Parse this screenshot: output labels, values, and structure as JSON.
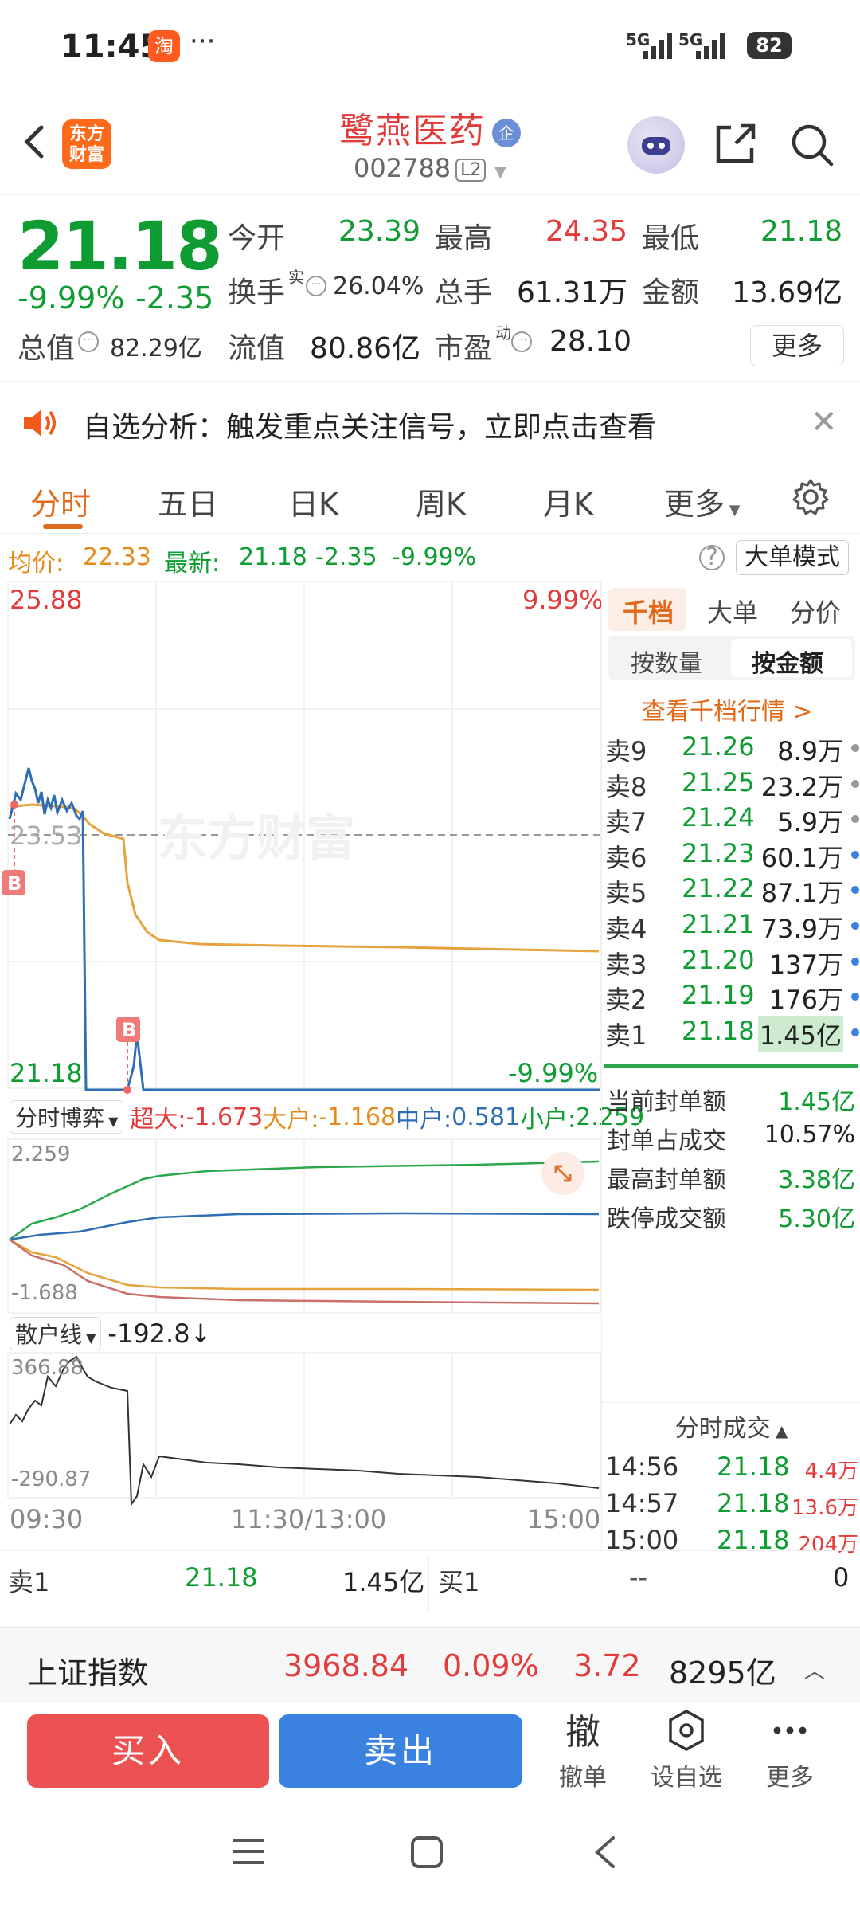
{
  "status": {
    "time": "11:45",
    "app_badge": "淘",
    "more": "···",
    "sig1": "5G",
    "sig2": "5G",
    "battery": "82"
  },
  "header": {
    "logo": "东方\n财富",
    "stock_name": "鹭燕医药",
    "badge": "企",
    "code": "002788",
    "level": "L2"
  },
  "quote": {
    "price": "21.18",
    "change_pct": "-9.99%",
    "change": "-2.35",
    "open_label": "今开",
    "open": "23.39",
    "high_label": "最高",
    "high": "24.35",
    "low_label": "最低",
    "low": "21.18",
    "turnover_label": "换手",
    "turnover_sup": "实",
    "turnover": "26.04%",
    "volume_label": "总手",
    "volume": "61.31万",
    "amount_label": "金额",
    "amount": "13.69亿",
    "mktcap_label": "总值",
    "mktcap": "82.29亿",
    "float_label": "流值",
    "float": "80.86亿",
    "pe_label": "市盈",
    "pe_sup": "动",
    "pe": "28.10",
    "more": "更多"
  },
  "notice": {
    "text": "自选分析：触发重点关注信号，立即点击查看"
  },
  "tabs": [
    "分时",
    "五日",
    "日K",
    "周K",
    "月K",
    "更多"
  ],
  "infoline": {
    "avg_label": "均价:",
    "avg": "22.33",
    "latest_label": "最新:",
    "latest": "21.18",
    "chg": "-2.35",
    "pct": "-9.99%",
    "help": "?",
    "mode": "大单模式"
  },
  "chart": {
    "y_top": "25.88",
    "y_mid": "23.53",
    "y_bottom": "21.18",
    "pct_top": "9.99%",
    "pct_bottom": "-9.99%",
    "marker": "B",
    "watermark": "东方财富",
    "game_label": "分时博弈",
    "flows": [
      {
        "label": "超大:",
        "value": "-1.673",
        "color": "#e33b3b"
      },
      {
        "label": "大户:",
        "value": "-1.168",
        "color": "#e58b1a"
      },
      {
        "label": "中户:",
        "value": "0.581",
        "color": "#2f6db5"
      },
      {
        "label": "小户:",
        "value": "2.259",
        "color": "#0f9d33"
      }
    ],
    "flow_top": "2.259",
    "flow_bottom": "-1.688",
    "retail_label": "散户线",
    "retail_value": "-192.8↓",
    "retail_top": "366.88",
    "retail_bottom": "-290.87",
    "time_start": "09:30",
    "time_mid": "11:30/13:00",
    "time_end": "15:00"
  },
  "right_panel": {
    "seg1": [
      "千档",
      "大单",
      "分价"
    ],
    "seg2": [
      "按数量",
      "按金额"
    ],
    "view_link": "查看千档行情 >",
    "orderbook": [
      {
        "level": "卖9",
        "price": "21.26",
        "vol": "8.9万",
        "dot": "#999"
      },
      {
        "level": "卖8",
        "price": "21.25",
        "vol": "23.2万",
        "dot": "#999"
      },
      {
        "level": "卖7",
        "price": "21.24",
        "vol": "5.9万",
        "dot": "#999"
      },
      {
        "level": "卖6",
        "price": "21.23",
        "vol": "60.1万",
        "dot": "#3b82e0"
      },
      {
        "level": "卖5",
        "price": "21.22",
        "vol": "87.1万",
        "dot": "#3b82e0"
      },
      {
        "level": "卖4",
        "price": "21.21",
        "vol": "73.9万",
        "dot": "#3b82e0"
      },
      {
        "level": "卖3",
        "price": "21.20",
        "vol": "137万",
        "dot": "#3b82e0"
      },
      {
        "level": "卖2",
        "price": "21.19",
        "vol": "176万",
        "dot": "#3b82e0"
      },
      {
        "level": "卖1",
        "price": "21.18",
        "vol": "1.45亿",
        "dot": "#3b82e0"
      }
    ],
    "seal": [
      {
        "label": "当前封单额",
        "value": "1.45亿",
        "color": "#0f9d33"
      },
      {
        "label": "封单占成交",
        "value": "10.57%",
        "color": "#222"
      },
      {
        "label": "最高封单额",
        "value": "3.38亿",
        "color": "#0f9d33"
      },
      {
        "label": "跌停成交额",
        "value": "5.30亿",
        "color": "#0f9d33"
      }
    ],
    "trades_title": "分时成交",
    "trades": [
      {
        "time": "14:56",
        "price": "21.18",
        "vol": "4.4万"
      },
      {
        "time": "14:57",
        "price": "21.18",
        "vol": "13.6万"
      },
      {
        "time": "15:00",
        "price": "21.18",
        "vol": "204万"
      }
    ]
  },
  "bottom_summary": {
    "left_label": "卖1",
    "left_price": "21.18",
    "left_vol": "1.45亿",
    "right_label": "买1",
    "right_price": "--",
    "right_vol": "0"
  },
  "index": {
    "name": "上证指数",
    "value": "3968.84",
    "pct": "0.09%",
    "chg": "3.72",
    "amount": "8295亿"
  },
  "actions": {
    "buy": "买入",
    "sell": "卖出",
    "cancel_icon": "撤",
    "cancel": "撤单",
    "watch": "设自选",
    "more": "更多"
  }
}
